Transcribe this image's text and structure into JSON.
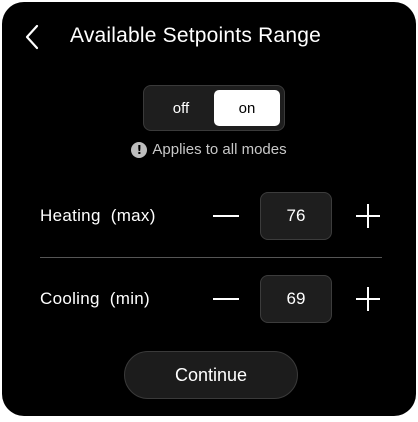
{
  "header": {
    "back_icon": "chevron-left-icon",
    "title": "Available Setpoints Range"
  },
  "toggle": {
    "off_label": "off",
    "on_label": "on",
    "selected": "on"
  },
  "hint": {
    "icon": "info-icon",
    "icon_glyph": "!",
    "text": "Applies to all modes"
  },
  "heating": {
    "label": "Heating  (max)",
    "value": "76"
  },
  "cooling": {
    "label": "Cooling  (min)",
    "value": "69"
  },
  "footer": {
    "continue_label": "Continue"
  },
  "colors": {
    "background": "#000000",
    "text": "#ffffff",
    "control_bg": "#1e1e1e",
    "toggle_active": "#ffffff"
  }
}
